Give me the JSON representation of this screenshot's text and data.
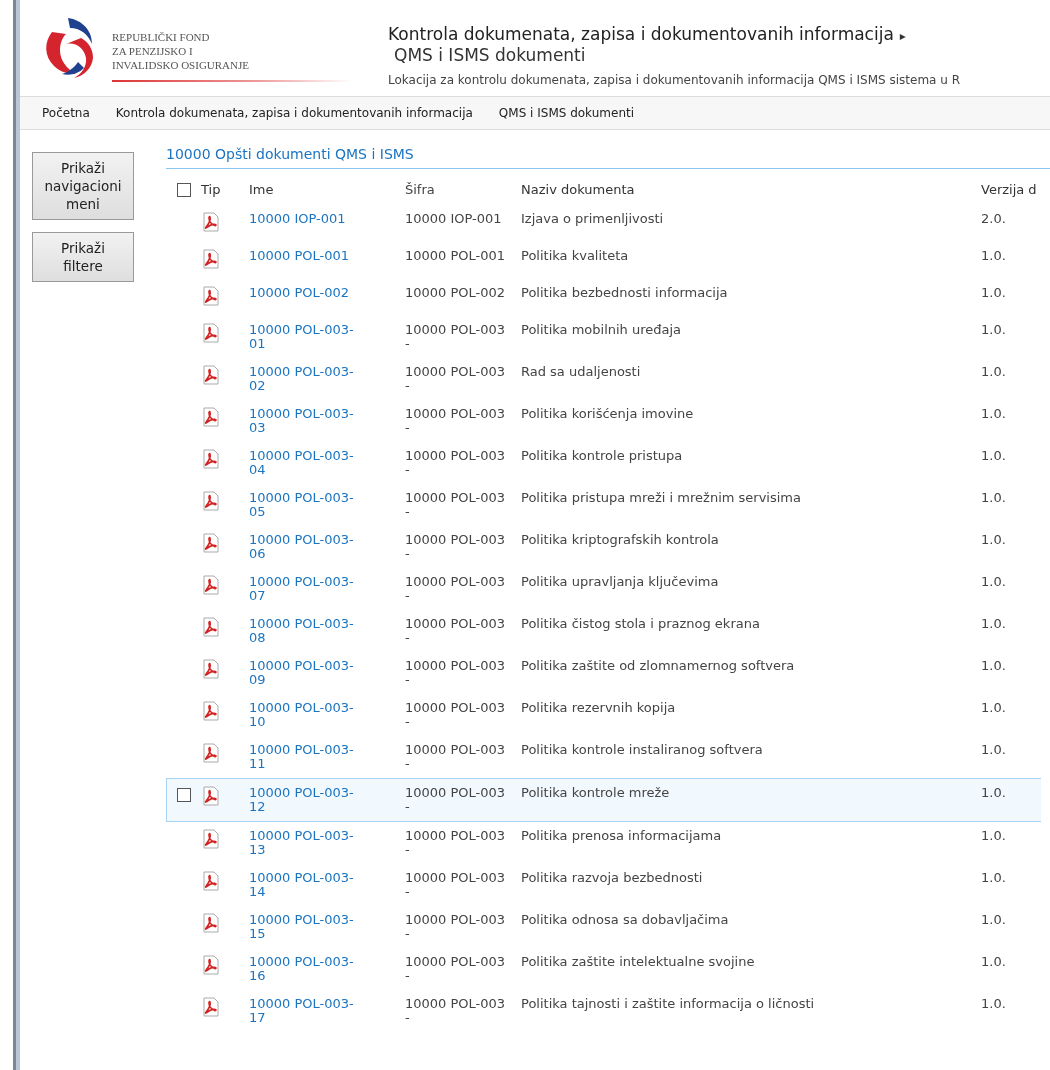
{
  "logo": {
    "lines": [
      "REPUBLIČKI FOND",
      "ZA PENZIJSKO I",
      "INVALIDSKO OSIGURANJE"
    ]
  },
  "header": {
    "parent": "Kontrola dokumenata, zapisa i dokumentovanih informacija",
    "arrow": "▸",
    "title": "QMS i ISMS dokumenti",
    "description": "Lokacija za kontrolu dokumenata, zapisa i dokumentovanih informacija QMS i ISMS sistema u R"
  },
  "breadcrumb": [
    "Početna",
    "Kontrola dokumenata, zapisa i dokumentovanih informacija",
    "QMS i ISMS dokumenti"
  ],
  "side_buttons": [
    "Prikaži navigacioni meni",
    "Prikaži filtere"
  ],
  "list": {
    "title": "10000 Opšti dokumenti QMS i ISMS",
    "select_all_checked": false,
    "columns": [
      "Tip",
      "Ime",
      "Šifra",
      "Naziv dokumenta",
      "Verzija d"
    ],
    "rows": [
      {
        "name": "10000 IOP-001",
        "code": "10000 IOP-001",
        "title": "Izjava o primenljivosti",
        "version": "2.0.",
        "selected": false
      },
      {
        "name": "10000 POL-001",
        "code": "10000 POL-001",
        "title": "Politika kvaliteta",
        "version": "1.0.",
        "selected": false
      },
      {
        "name": "10000 POL-002",
        "code": "10000 POL-002",
        "title": "Politika bezbednosti informacija",
        "version": "1.0.",
        "selected": false
      },
      {
        "name": "10000 POL-003-01",
        "code": "10000 POL-003-",
        "title": "Politika mobilnih uređaja",
        "version": "1.0.",
        "selected": false
      },
      {
        "name": "10000 POL-003-02",
        "code": "10000 POL-003-",
        "title": "Rad sa udaljenosti",
        "version": "1.0.",
        "selected": false
      },
      {
        "name": "10000 POL-003-03",
        "code": "10000 POL-003-",
        "title": "Politika korišćenja imovine",
        "version": "1.0.",
        "selected": false
      },
      {
        "name": "10000 POL-003-04",
        "code": "10000 POL-003-",
        "title": "Politika kontrole pristupa",
        "version": "1.0.",
        "selected": false
      },
      {
        "name": "10000 POL-003-05",
        "code": "10000 POL-003-",
        "title": "Politika pristupa mreži i mrežnim servisima",
        "version": "1.0.",
        "selected": false
      },
      {
        "name": "10000 POL-003-06",
        "code": "10000 POL-003-",
        "title": "Politika kriptografskih kontrola",
        "version": "1.0.",
        "selected": false
      },
      {
        "name": "10000 POL-003-07",
        "code": "10000 POL-003-",
        "title": "Politika upravljanja ključevima",
        "version": "1.0.",
        "selected": false
      },
      {
        "name": "10000 POL-003-08",
        "code": "10000 POL-003-",
        "title": "Politika čistog stola i  praznog ekrana",
        "version": "1.0.",
        "selected": false
      },
      {
        "name": "10000 POL-003-09",
        "code": "10000 POL-003-",
        "title": "Politika zaštite od zlomnamernog softvera",
        "version": "1.0.",
        "selected": false
      },
      {
        "name": "10000 POL-003-10",
        "code": "10000 POL-003-",
        "title": "Politika rezervnih kopija",
        "version": "1.0.",
        "selected": false
      },
      {
        "name": "10000 POL-003-11",
        "code": "10000 POL-003-",
        "title": "Politika kontrole instaliranog softvera",
        "version": "1.0.",
        "selected": false
      },
      {
        "name": "10000 POL-003-12",
        "code": "10000 POL-003-",
        "title": "Politika kontrole mreže",
        "version": "1.0.",
        "selected": true
      },
      {
        "name": "10000 POL-003-13",
        "code": "10000 POL-003-",
        "title": "Politika prenosa informacijama",
        "version": "1.0.",
        "selected": false
      },
      {
        "name": "10000 POL-003-14",
        "code": "10000 POL-003-",
        "title": "Politika razvoja bezbednosti",
        "version": "1.0.",
        "selected": false
      },
      {
        "name": "10000 POL-003-15",
        "code": "10000 POL-003-",
        "title": "Politika odnosa sa dobavljačima",
        "version": "1.0.",
        "selected": false
      },
      {
        "name": "10000 POL-003-16",
        "code": "10000 POL-003-",
        "title": "Politika zaštite intelektualne svojine",
        "version": "1.0.",
        "selected": false
      },
      {
        "name": "10000 POL-003-17",
        "code": "10000 POL-003-",
        "title": "Politika tajnosti i zaštite informacija o ličnosti",
        "version": "1.0.",
        "selected": false
      }
    ]
  }
}
